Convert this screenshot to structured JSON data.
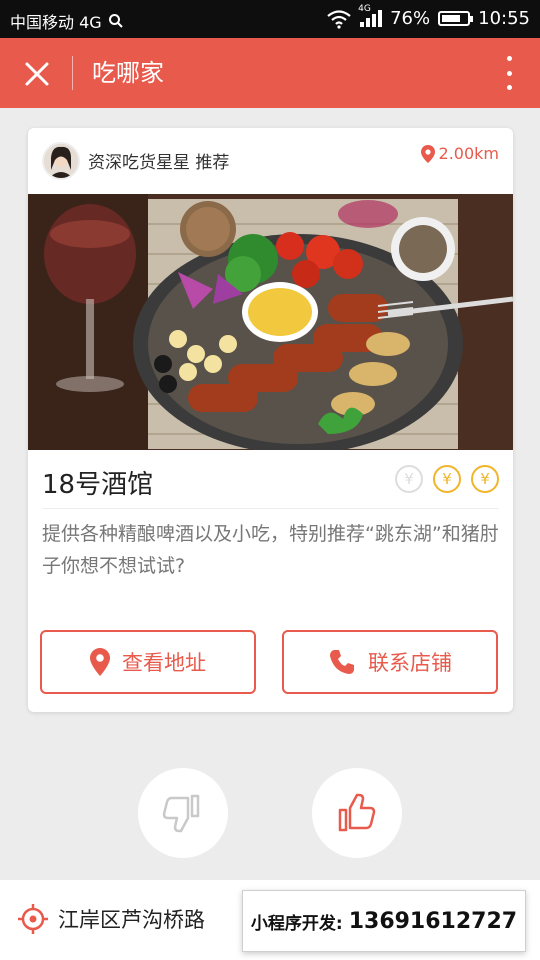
{
  "status_bar": {
    "carrier": "中国移动 4G",
    "network": "4G",
    "battery_text": "76%",
    "battery_level": 0.76,
    "time": "10:55"
  },
  "app_bar": {
    "title": "吃哪家"
  },
  "card": {
    "recommender": "资深吃货星星 推荐",
    "distance": "2.00km",
    "restaurant_name": "18号酒馆",
    "price_level": {
      "active": 2,
      "total": 3,
      "symbol": "¥"
    },
    "description": "提供各种精酿啤酒以及小吃，特别推荐“跳东湖”和猪肘子你想不想试试?",
    "view_address_label": "查看地址",
    "contact_store_label": "联系店铺"
  },
  "footer": {
    "location": "江岸区芦沟桥路",
    "promo_label": "小程序开发:",
    "promo_phone": "13691612727"
  },
  "colors": {
    "accent": "#e85a4c",
    "price_active": "#f0b52a"
  }
}
